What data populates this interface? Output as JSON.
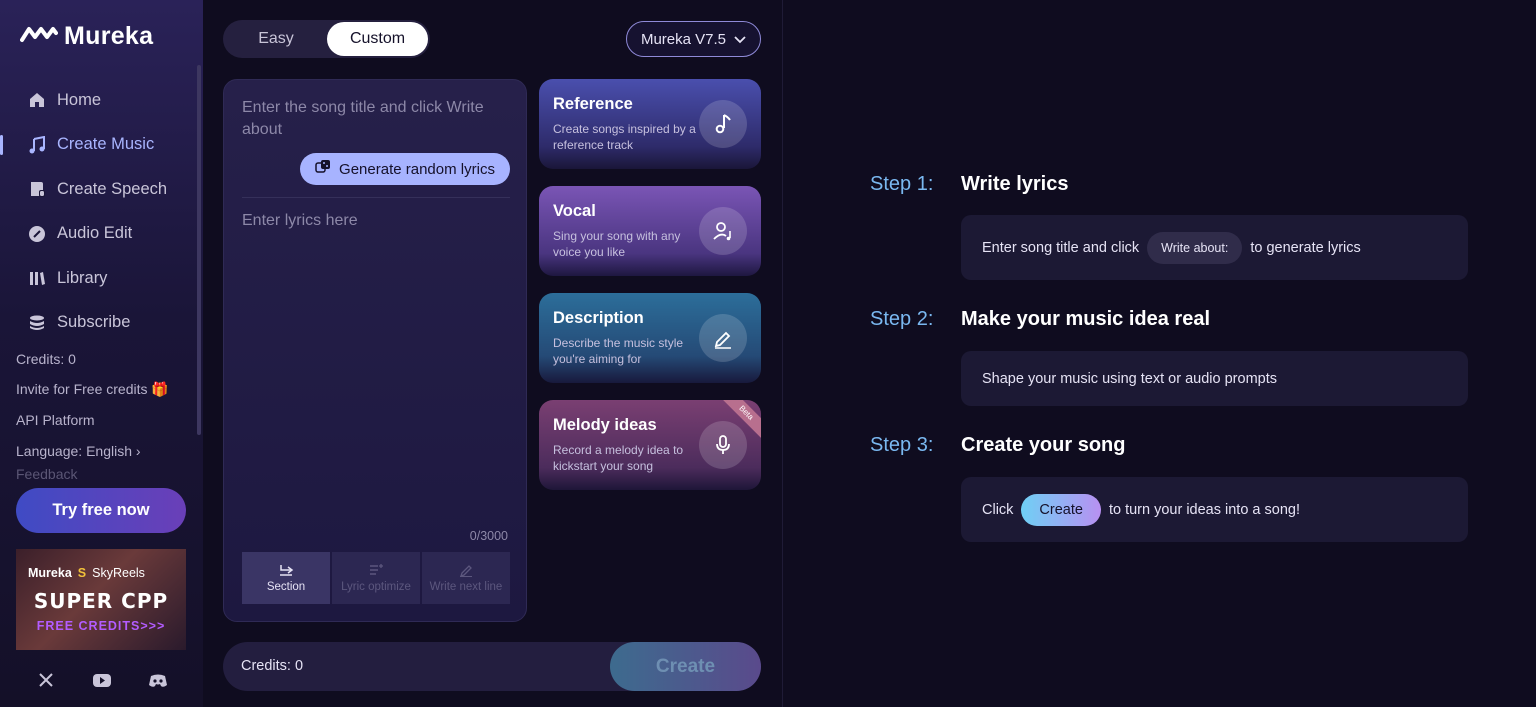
{
  "brand": {
    "name": "Mureka"
  },
  "nav": {
    "items": [
      {
        "label": "Home",
        "icon": "home-icon"
      },
      {
        "label": "Create Music",
        "icon": "music-note-icon",
        "active": true
      },
      {
        "label": "Create Speech",
        "icon": "speech-icon"
      },
      {
        "label": "Audio Edit",
        "icon": "audio-edit-icon"
      },
      {
        "label": "Library",
        "icon": "library-icon"
      },
      {
        "label": "Subscribe",
        "icon": "subscribe-icon"
      }
    ]
  },
  "side_links": {
    "credits": "Credits: 0",
    "invite": "Invite for Free credits 🎁",
    "api": "API Platform",
    "language": "Language: English ›",
    "feedback": "Feedback"
  },
  "try_button": "Try free now",
  "promo": {
    "brand_left": "Mureka",
    "brand_right": "SkyReels",
    "headline": "SUPER CPP",
    "sub": "FREE CREDITS>>>"
  },
  "mode": {
    "easy": "Easy",
    "custom": "Custom",
    "selected": "Custom"
  },
  "version": {
    "label": "Mureka V7.5"
  },
  "lyrics": {
    "title_placeholder": "Enter the song title and click Write about",
    "generate_label": "Generate random lyrics",
    "lyrics_placeholder": "Enter lyrics here",
    "counter": "0/3000",
    "tools": [
      {
        "label": "Section",
        "icon": "section-icon",
        "active": true
      },
      {
        "label": "Lyric optimize",
        "icon": "lyric-optimize-icon",
        "active": false
      },
      {
        "label": "Write next line",
        "icon": "pencil-icon",
        "active": false
      }
    ]
  },
  "cards": [
    {
      "title": "Reference",
      "desc": "Create songs inspired by a reference track",
      "icon": "music-note-icon"
    },
    {
      "title": "Vocal",
      "desc": "Sing your song with any voice you like",
      "icon": "vocal-icon"
    },
    {
      "title": "Description",
      "desc": "Describe the music style you're aiming for",
      "icon": "pencil-icon"
    },
    {
      "title": "Melody ideas",
      "desc": "Record a melody idea to kickstart your song",
      "icon": "microphone-icon",
      "badge": "Beta"
    }
  ],
  "footer": {
    "credits": "Credits: 0",
    "create": "Create"
  },
  "steps": [
    {
      "label": "Step 1:",
      "title": "Write lyrics",
      "pre": "Enter song title and click",
      "chip": "Write about:",
      "post": "to generate lyrics"
    },
    {
      "label": "Step 2:",
      "title": "Make your music idea real",
      "text": "Shape your music using text or audio prompts"
    },
    {
      "label": "Step 3:",
      "title": "Create your song",
      "pre": "Click",
      "chip": "Create",
      "post": "to turn your ideas into a song!"
    }
  ],
  "colors": {
    "accent": "#a9b5ff",
    "step_label": "#7ab8f0",
    "background": "#0f0c1f"
  }
}
